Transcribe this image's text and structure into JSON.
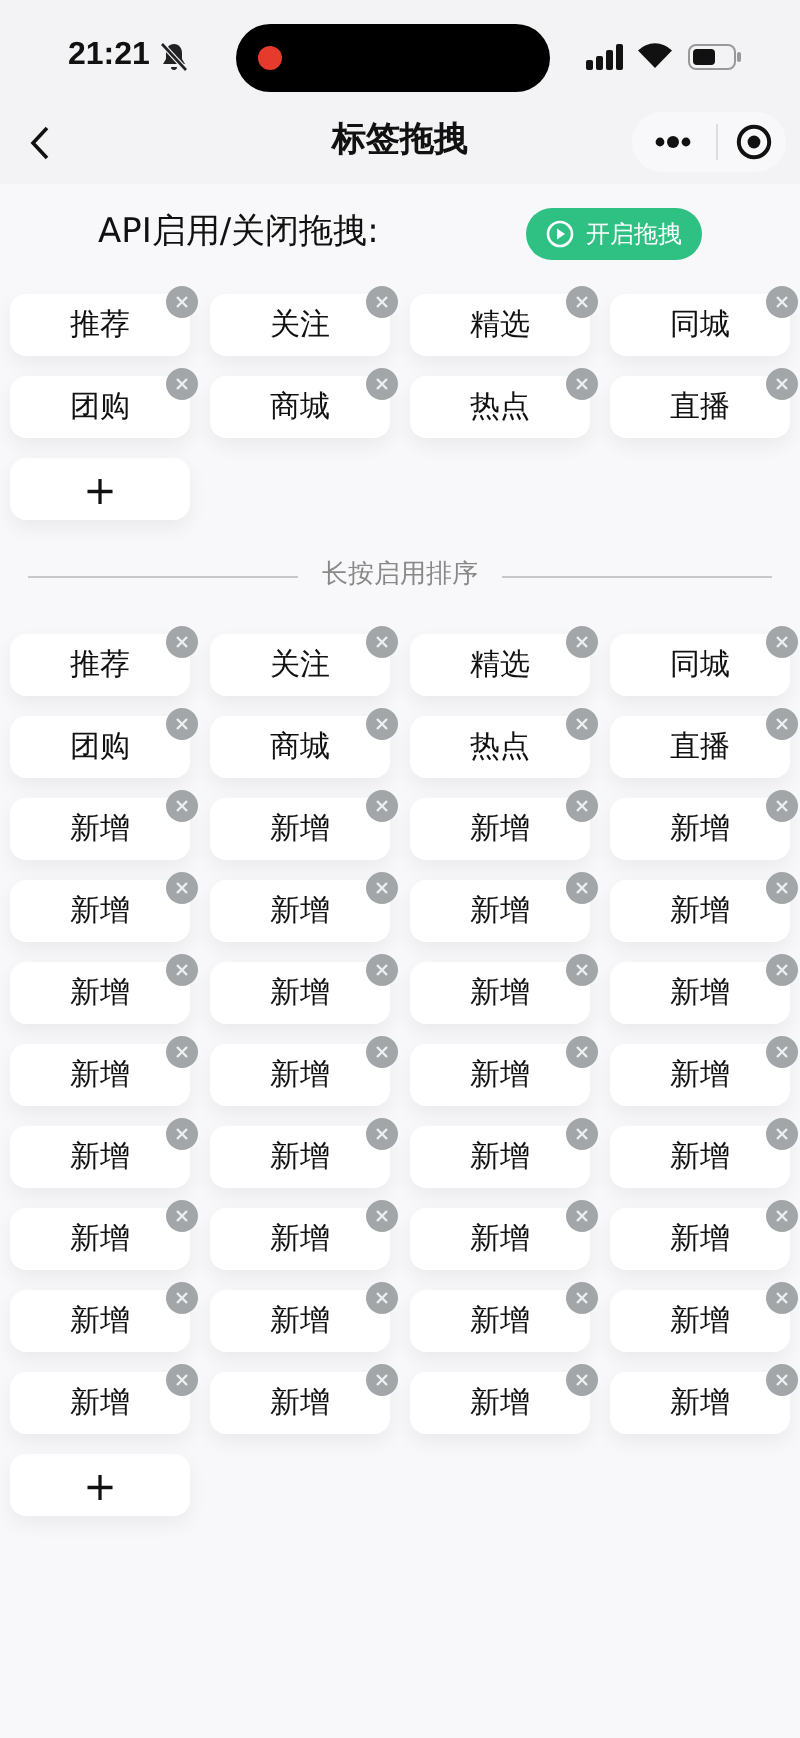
{
  "status_bar": {
    "time": "21:21"
  },
  "nav": {
    "title": "标签拖拽"
  },
  "api_row": {
    "label": "API启用/关闭拖拽:",
    "button": "开启拖拽"
  },
  "tags_top": [
    {
      "label": "推荐"
    },
    {
      "label": "关注"
    },
    {
      "label": "精选"
    },
    {
      "label": "同城"
    },
    {
      "label": "团购"
    },
    {
      "label": "商城"
    },
    {
      "label": "热点"
    },
    {
      "label": "直播"
    }
  ],
  "add_top": "+",
  "divider": "长按启用排序",
  "tags_bottom": [
    {
      "label": "推荐"
    },
    {
      "label": "关注"
    },
    {
      "label": "精选"
    },
    {
      "label": "同城"
    },
    {
      "label": "团购"
    },
    {
      "label": "商城"
    },
    {
      "label": "热点"
    },
    {
      "label": "直播"
    },
    {
      "label": "新增"
    },
    {
      "label": "新增"
    },
    {
      "label": "新增"
    },
    {
      "label": "新增"
    },
    {
      "label": "新增"
    },
    {
      "label": "新增"
    },
    {
      "label": "新增"
    },
    {
      "label": "新增"
    },
    {
      "label": "新增"
    },
    {
      "label": "新增"
    },
    {
      "label": "新增"
    },
    {
      "label": "新增"
    },
    {
      "label": "新增"
    },
    {
      "label": "新增"
    },
    {
      "label": "新增"
    },
    {
      "label": "新增"
    },
    {
      "label": "新增"
    },
    {
      "label": "新增"
    },
    {
      "label": "新增"
    },
    {
      "label": "新增"
    },
    {
      "label": "新增"
    },
    {
      "label": "新增"
    },
    {
      "label": "新增"
    },
    {
      "label": "新增"
    },
    {
      "label": "新增"
    },
    {
      "label": "新增"
    },
    {
      "label": "新增"
    },
    {
      "label": "新增"
    },
    {
      "label": "新增"
    },
    {
      "label": "新增"
    },
    {
      "label": "新增"
    },
    {
      "label": "新增"
    }
  ],
  "add_bottom": "+"
}
